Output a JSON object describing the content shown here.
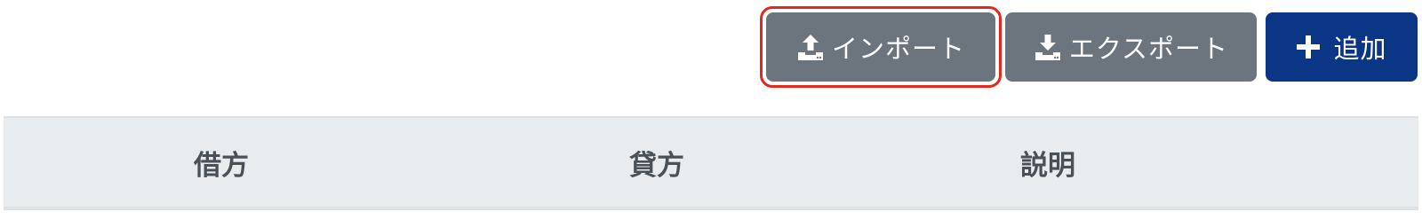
{
  "toolbar": {
    "import_label": "インポート",
    "export_label": "エクスポート",
    "add_label": "追加",
    "import_icon": "upload-tray-icon",
    "export_icon": "download-tray-icon",
    "add_icon": "plus-icon"
  },
  "table": {
    "columns": [
      {
        "label": "借方"
      },
      {
        "label": "貸方"
      },
      {
        "label": "説明"
      }
    ]
  },
  "colors": {
    "secondary_button": "#6c757d",
    "primary_button": "#0b3585",
    "highlight": "#e4281c",
    "table_header_bg": "#e9ecef",
    "table_header_text": "#495057"
  }
}
